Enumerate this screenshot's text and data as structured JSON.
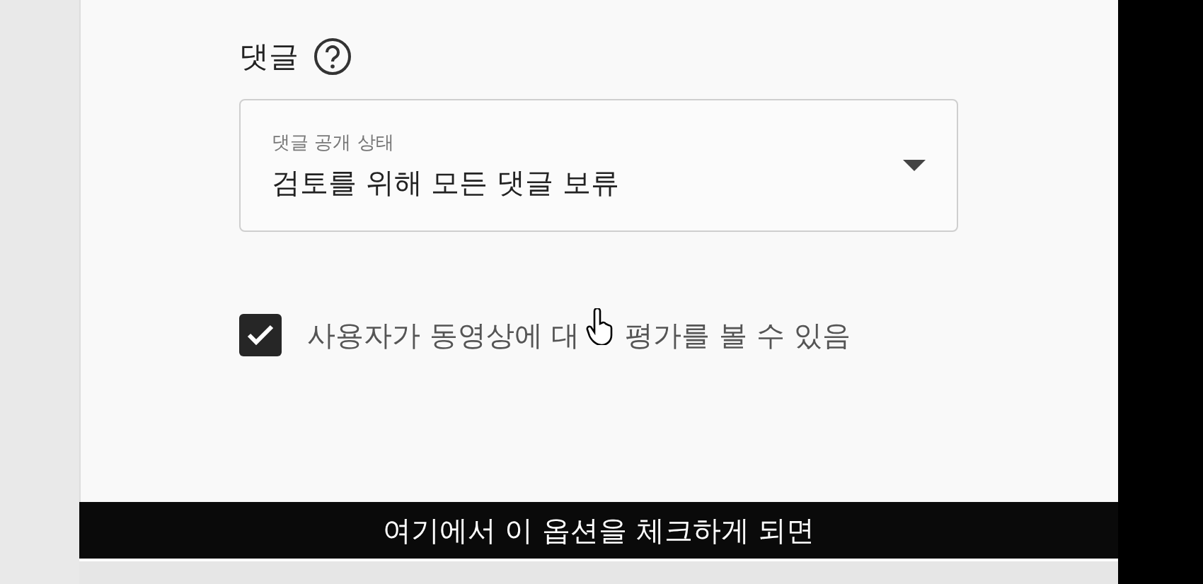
{
  "section": {
    "title": "댓글"
  },
  "visibility_select": {
    "label": "댓글 공개 상태",
    "value": "검토를 위해 모든 댓글 보류"
  },
  "ratings_option": {
    "label_parts": [
      "사용자가 동영상에 대",
      "평가를 볼 수 있음"
    ],
    "checked": true
  },
  "subtitle": "여기에서 이 옵션을 체크하게 되면"
}
